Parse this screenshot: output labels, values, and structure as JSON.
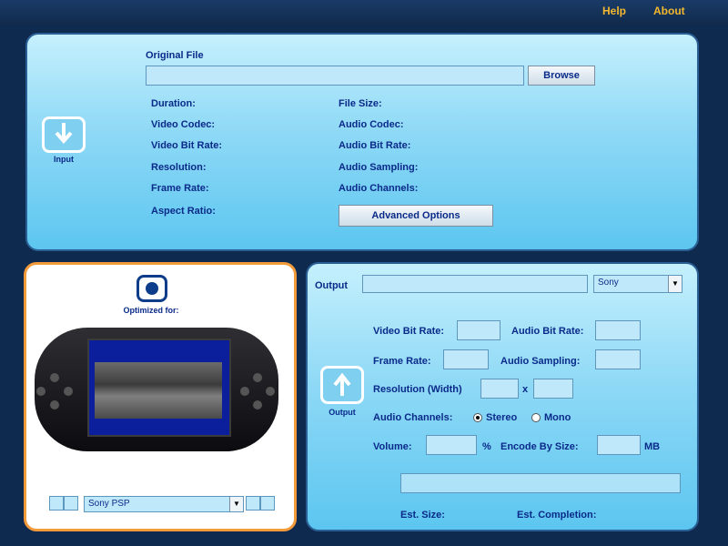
{
  "topbar": {
    "help": "Help",
    "about": "About"
  },
  "input": {
    "original_file_label": "Original File",
    "browse_label": "Browse",
    "icon_caption": "Input",
    "fields_left": [
      "Duration:",
      "Video Codec:",
      "Video Bit Rate:",
      "Resolution:",
      "Frame Rate:",
      "Aspect Ratio:"
    ],
    "fields_right": [
      "File Size:",
      "Audio Codec:",
      "Audio Bit Rate:",
      "Audio Sampling:",
      "Audio Channels:"
    ],
    "advanced_label": "Advanced Options"
  },
  "device": {
    "optimized_label": "Optimized for:",
    "selected_device": "Sony PSP"
  },
  "output": {
    "output_label": "Output",
    "format_value": "Sony",
    "icon_caption": "Output",
    "video_bit_rate": "Video Bit Rate:",
    "audio_bit_rate": "Audio Bit Rate:",
    "frame_rate": "Frame Rate:",
    "audio_sampling": "Audio Sampling:",
    "resolution": "Resolution (Width)",
    "resolution_sep": "x",
    "audio_channels": "Audio Channels:",
    "stereo": "Stereo",
    "mono": "Mono",
    "volume": "Volume:",
    "volume_unit": "%",
    "encode_by_size": "Encode By Size:",
    "size_unit": "MB",
    "est_size": "Est. Size:",
    "est_completion": "Est. Completion:"
  },
  "colors": {
    "accent": "#f3b82d",
    "background": "#0f2a4f",
    "panel": "#8fd9f6",
    "label": "#0a2a8a"
  }
}
